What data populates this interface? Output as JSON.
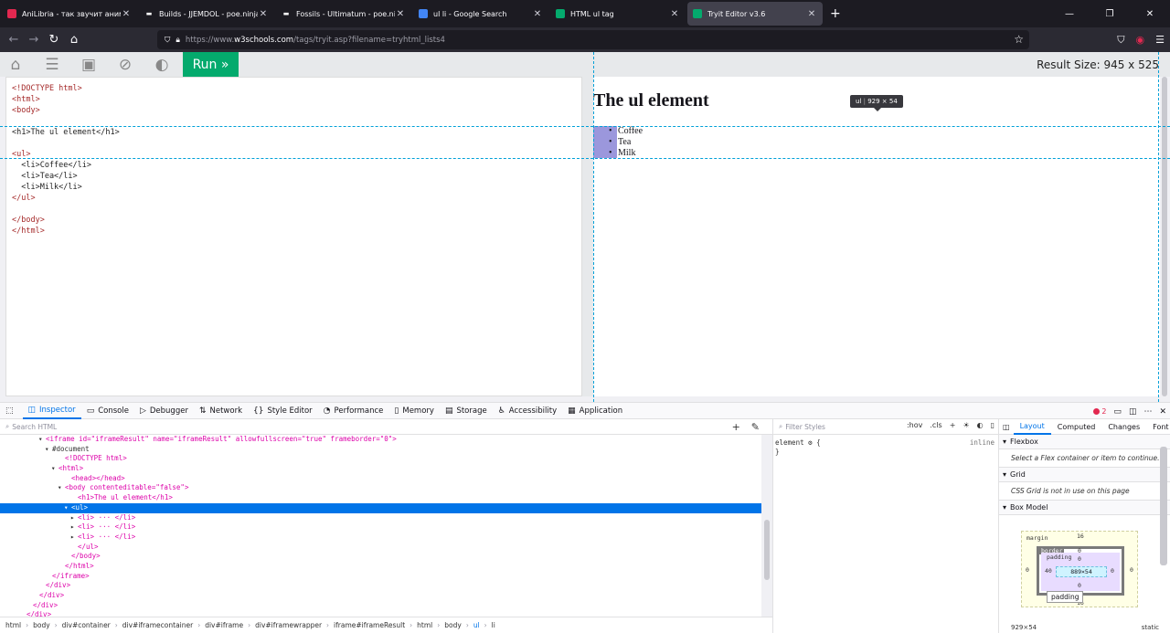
{
  "tabs": [
    {
      "title": "AniLibria - так звучит аниме!",
      "icon": "anilibria-icon",
      "color": "#e22850",
      "active": false
    },
    {
      "title": "Builds - JJEMDOL - poe.ninja",
      "icon": "poe-ninja-icon",
      "color": "#ffffff",
      "active": false
    },
    {
      "title": "Fossils - Ultimatum - poe.ninja",
      "icon": "poe-ninja-icon",
      "color": "#ffffff",
      "active": false
    },
    {
      "title": "ul li - Google Search",
      "icon": "google-icon",
      "color": "#4285f4",
      "active": false
    },
    {
      "title": "HTML ul tag",
      "icon": "w3schools-icon",
      "color": "#04aa6d",
      "active": false
    },
    {
      "title": "Tryit Editor v3.6",
      "icon": "w3schools-icon",
      "color": "#04aa6d",
      "active": true
    }
  ],
  "url": {
    "prefix": "https://www.",
    "domain": "w3schools.com",
    "path": "/tags/tryit.asp?filename=tryhtml_lists4"
  },
  "toolbar": {
    "run_label": "Run »",
    "result_size": "Result Size: 945 x 525"
  },
  "code_lines": [
    "<!DOCTYPE html>",
    "<html>",
    "<body>",
    "",
    "<h1>The ul element</h1>",
    "",
    "<ul>",
    "  <li>Coffee</li>",
    "  <li>Tea</li>",
    "  <li>Milk</li>",
    "</ul>",
    "",
    "</body>",
    "</html>"
  ],
  "result": {
    "heading": "The ul element",
    "items": [
      "Coffee",
      "Tea",
      "Milk"
    ],
    "tooltip_tag": "ul",
    "tooltip_size": "929 × 54"
  },
  "devtools": {
    "tabs": [
      "Inspector",
      "Console",
      "Debugger",
      "Network",
      "Style Editor",
      "Performance",
      "Memory",
      "Storage",
      "Accessibility",
      "Application"
    ],
    "tab_icons": [
      "◫",
      "▭",
      "▷",
      "⇅",
      "{}",
      "◔",
      "▯",
      "▤",
      "♿",
      "▦"
    ],
    "error_count": "2",
    "search_placeholder": "Search HTML",
    "filter_placeholder": "Filter Styles",
    "hov": ":hov",
    "cls": ".cls",
    "tree": [
      {
        "indent": 6,
        "arrow": "▾",
        "html": "<iframe id=\"iframeResult\" name=\"iframeResult\" allowfullscreen=\"true\" frameborder=\"0\">",
        "sel": false
      },
      {
        "indent": 7,
        "arrow": "▾",
        "html": "#document",
        "sel": false
      },
      {
        "indent": 9,
        "arrow": "",
        "html": "<!DOCTYPE html>",
        "sel": false
      },
      {
        "indent": 8,
        "arrow": "▾",
        "html": "<html>",
        "sel": false
      },
      {
        "indent": 10,
        "arrow": "",
        "html": "<head></head>",
        "sel": false
      },
      {
        "indent": 9,
        "arrow": "▾",
        "html": "<body contenteditable=\"false\">",
        "sel": false
      },
      {
        "indent": 11,
        "arrow": "",
        "html": "<h1>The ul element</h1>",
        "sel": false
      },
      {
        "indent": 10,
        "arrow": "▾",
        "html": "<ul>",
        "sel": true
      },
      {
        "indent": 11,
        "arrow": "▸",
        "html": "<li> ··· </li>",
        "sel": false
      },
      {
        "indent": 11,
        "arrow": "▸",
        "html": "<li> ··· </li>",
        "sel": false
      },
      {
        "indent": 11,
        "arrow": "▸",
        "html": "<li> ··· </li>",
        "sel": false
      },
      {
        "indent": 11,
        "arrow": "",
        "html": "</ul>",
        "sel": false
      },
      {
        "indent": 10,
        "arrow": "",
        "html": "</body>",
        "sel": false
      },
      {
        "indent": 9,
        "arrow": "",
        "html": "</html>",
        "sel": false
      },
      {
        "indent": 7,
        "arrow": "",
        "html": "</iframe>",
        "sel": false
      },
      {
        "indent": 6,
        "arrow": "",
        "html": "</div>",
        "sel": false
      },
      {
        "indent": 5,
        "arrow": "",
        "html": "</div>",
        "sel": false
      },
      {
        "indent": 4,
        "arrow": "",
        "html": "</div>",
        "sel": false
      },
      {
        "indent": 3,
        "arrow": "",
        "html": "</div>",
        "sel": false
      }
    ],
    "breadcrumbs": [
      "html",
      "body",
      "div#container",
      "div#iframecontainer",
      "div#iframe",
      "div#iframewrapper",
      "iframe#iframeResult",
      "html",
      "body",
      "ul",
      "li"
    ],
    "rule_selector": "element",
    "rule_open": "{",
    "rule_close": "}",
    "rule_source": "inline",
    "layout_tabs": [
      "Layout",
      "Computed",
      "Changes",
      "Font"
    ],
    "flexbox_title": "Flexbox",
    "flexbox_note": "Select a Flex container or item to continue.",
    "grid_title": "Grid",
    "grid_note": "CSS Grid is not in use on this page",
    "boxmodel_title": "Box Model",
    "box": {
      "margin_label": "margin",
      "margin_top": "16",
      "margin_left": "0",
      "margin_right": "0",
      "margin_bottom": "16",
      "border_label": "border",
      "border_top": "0",
      "padding_label": "padding",
      "padding_top": "0",
      "padding_left": "40",
      "padding_right": "0",
      "padding_bottom": "0",
      "content": "889×54"
    },
    "box_footer_size": "929×54",
    "box_footer_position": "static"
  }
}
